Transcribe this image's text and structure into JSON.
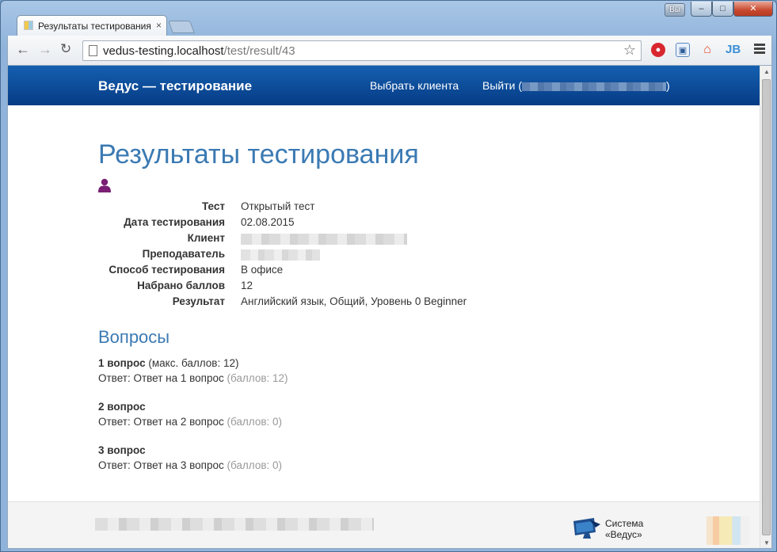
{
  "window": {
    "user_badge": "Вы",
    "minimize": "–",
    "maximize": "□",
    "close": "✕"
  },
  "tab": {
    "title": "Результаты тестирования",
    "close": "×"
  },
  "toolbar": {
    "url_host": "vedus-testing.localhost",
    "url_path": "/test/result/43",
    "ext_jb": "JB"
  },
  "navbar": {
    "brand": "Ведус — тестирование",
    "choose_client": "Выбрать клиента",
    "logout_prefix": "Выйти (",
    "logout_suffix": ")"
  },
  "page": {
    "title": "Результаты тестирования"
  },
  "details": {
    "rows": [
      {
        "label": "Тест",
        "value": "Открытый тест"
      },
      {
        "label": "Дата тестирования",
        "value": "02.08.2015"
      },
      {
        "label": "Клиент",
        "value": ""
      },
      {
        "label": "Преподаватель",
        "value": ""
      },
      {
        "label": "Способ тестирования",
        "value": "В офисе"
      },
      {
        "label": "Набрано баллов",
        "value": "12"
      },
      {
        "label": "Результат",
        "value": "Английский язык, Общий, Уровень 0 Beginner"
      }
    ]
  },
  "questions": {
    "section_title": "Вопросы",
    "items": [
      {
        "title": "1 вопрос",
        "meta": " (макс. баллов: 12)",
        "answer": "Ответ: Ответ на 1 вопрос",
        "score": " (баллов: 12)"
      },
      {
        "title": "2 вопрос",
        "meta": "",
        "answer": "Ответ: Ответ на 2 вопрос",
        "score": " (баллов: 0)"
      },
      {
        "title": "3 вопрос",
        "meta": "",
        "answer": "Ответ: Ответ на 3 вопрос",
        "score": " (баллов: 0)"
      }
    ]
  },
  "footer": {
    "logo_line1": "Система",
    "logo_line2": "«Ведус»"
  }
}
